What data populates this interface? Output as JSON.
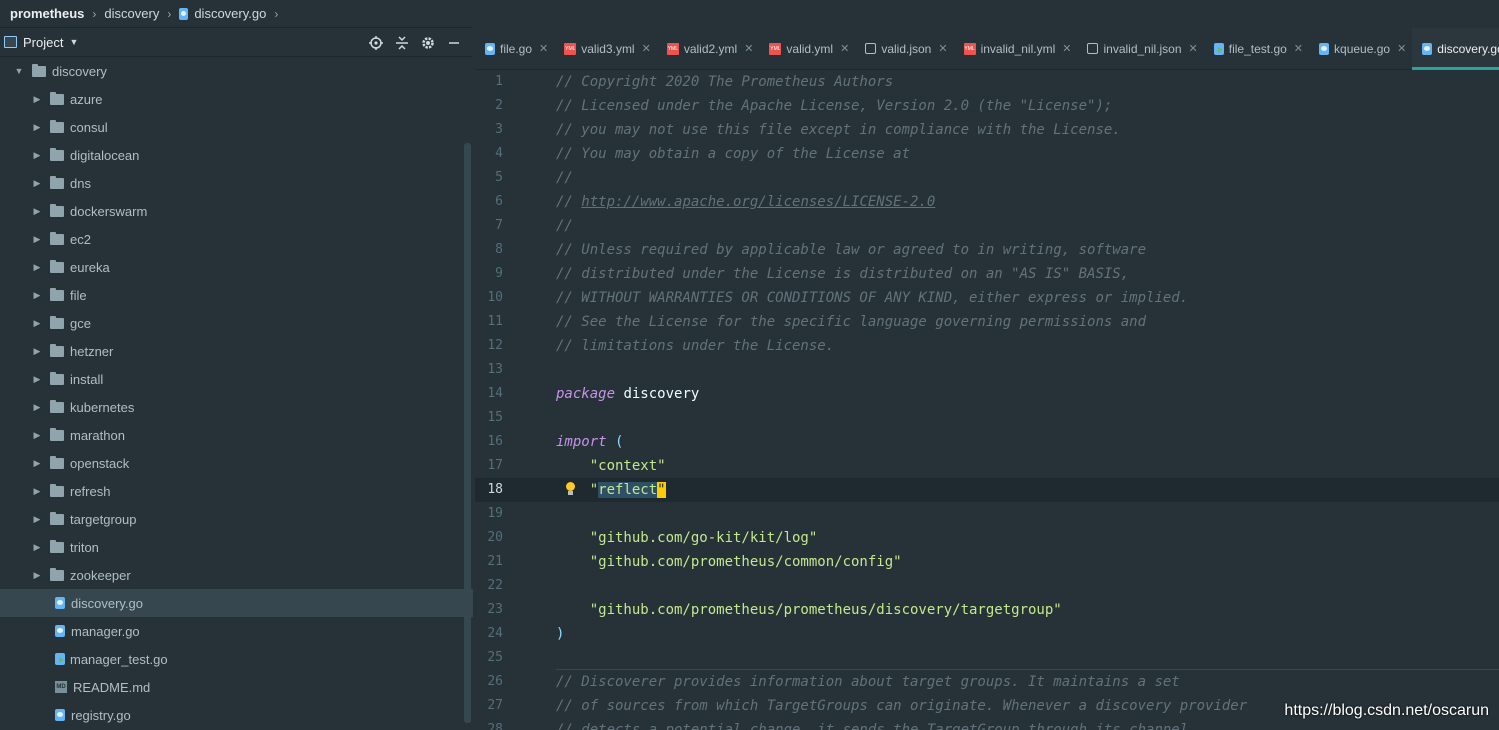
{
  "breadcrumb": {
    "root": "prometheus",
    "folder": "discovery",
    "file": "discovery.go"
  },
  "project": {
    "label": "Project"
  },
  "tree": [
    {
      "name": "discovery",
      "kind": "folder",
      "expanded": true,
      "depth": 0
    },
    {
      "name": "azure",
      "kind": "folder",
      "depth": 1
    },
    {
      "name": "consul",
      "kind": "folder",
      "depth": 1
    },
    {
      "name": "digitalocean",
      "kind": "folder",
      "depth": 1
    },
    {
      "name": "dns",
      "kind": "folder",
      "depth": 1
    },
    {
      "name": "dockerswarm",
      "kind": "folder",
      "depth": 1
    },
    {
      "name": "ec2",
      "kind": "folder",
      "depth": 1
    },
    {
      "name": "eureka",
      "kind": "folder",
      "depth": 1
    },
    {
      "name": "file",
      "kind": "folder",
      "depth": 1
    },
    {
      "name": "gce",
      "kind": "folder",
      "depth": 1
    },
    {
      "name": "hetzner",
      "kind": "folder",
      "depth": 1
    },
    {
      "name": "install",
      "kind": "folder",
      "depth": 1
    },
    {
      "name": "kubernetes",
      "kind": "folder",
      "depth": 1
    },
    {
      "name": "marathon",
      "kind": "folder",
      "depth": 1
    },
    {
      "name": "openstack",
      "kind": "folder",
      "depth": 1
    },
    {
      "name": "refresh",
      "kind": "folder",
      "depth": 1
    },
    {
      "name": "targetgroup",
      "kind": "folder",
      "depth": 1
    },
    {
      "name": "triton",
      "kind": "folder",
      "depth": 1
    },
    {
      "name": "zookeeper",
      "kind": "folder",
      "depth": 1
    },
    {
      "name": "discovery.go",
      "kind": "go",
      "depth": 1,
      "selected": true
    },
    {
      "name": "manager.go",
      "kind": "go",
      "depth": 1
    },
    {
      "name": "manager_test.go",
      "kind": "test",
      "depth": 1
    },
    {
      "name": "README.md",
      "kind": "md",
      "depth": 1
    },
    {
      "name": "registry.go",
      "kind": "go",
      "depth": 1
    }
  ],
  "tabs": [
    {
      "label": "file.go",
      "kind": "go"
    },
    {
      "label": "valid3.yml",
      "kind": "yml"
    },
    {
      "label": "valid2.yml",
      "kind": "yml"
    },
    {
      "label": "valid.yml",
      "kind": "yml"
    },
    {
      "label": "valid.json",
      "kind": "json"
    },
    {
      "label": "invalid_nil.yml",
      "kind": "yml"
    },
    {
      "label": "invalid_nil.json",
      "kind": "json"
    },
    {
      "label": "file_test.go",
      "kind": "test"
    },
    {
      "label": "kqueue.go",
      "kind": "go"
    },
    {
      "label": "discovery.go",
      "kind": "go",
      "active": true
    }
  ],
  "icon_names": {
    "yml_badge": "YML",
    "md_badge": "MD"
  },
  "code": [
    {
      "n": "1",
      "tokens": [
        [
          "comment",
          "// Copyright 2020 The Prometheus Authors"
        ]
      ]
    },
    {
      "n": "2",
      "tokens": [
        [
          "comment",
          "// Licensed under the Apache License, Version 2.0 (the \"License\");"
        ]
      ]
    },
    {
      "n": "3",
      "tokens": [
        [
          "comment",
          "// you may not use this file except in compliance with the License."
        ]
      ]
    },
    {
      "n": "4",
      "tokens": [
        [
          "comment",
          "// You may obtain a copy of the License at"
        ]
      ]
    },
    {
      "n": "5",
      "tokens": [
        [
          "comment",
          "//"
        ]
      ]
    },
    {
      "n": "6",
      "tokens": [
        [
          "comment",
          "// "
        ],
        [
          "link",
          "http://www.apache.org/licenses/LICENSE-2.0"
        ]
      ]
    },
    {
      "n": "7",
      "tokens": [
        [
          "comment",
          "//"
        ]
      ]
    },
    {
      "n": "8",
      "tokens": [
        [
          "comment",
          "// Unless required by applicable law or agreed to in writing, software"
        ]
      ]
    },
    {
      "n": "9",
      "tokens": [
        [
          "comment",
          "// distributed under the License is distributed on an \"AS IS\" BASIS,"
        ]
      ]
    },
    {
      "n": "10",
      "tokens": [
        [
          "comment",
          "// WITHOUT WARRANTIES OR CONDITIONS OF ANY KIND, either express or implied."
        ]
      ]
    },
    {
      "n": "11",
      "tokens": [
        [
          "comment",
          "// See the License for the specific language governing permissions and"
        ]
      ]
    },
    {
      "n": "12",
      "tokens": [
        [
          "comment",
          "// limitations under the License."
        ]
      ]
    },
    {
      "n": "13",
      "tokens": []
    },
    {
      "n": "14",
      "tokens": [
        [
          "kw",
          "package"
        ],
        [
          "plain",
          " discovery"
        ]
      ]
    },
    {
      "n": "15",
      "tokens": []
    },
    {
      "n": "16",
      "tokens": [
        [
          "kw",
          "import"
        ],
        [
          "punct",
          " ("
        ]
      ]
    },
    {
      "n": "17",
      "tokens": [
        [
          "str",
          "    \"context\""
        ]
      ]
    },
    {
      "n": "18",
      "tokens": [
        [
          "str",
          "    \""
        ],
        [
          "sel",
          "reflect"
        ],
        [
          "caret",
          "\""
        ]
      ],
      "current": true
    },
    {
      "n": "19",
      "tokens": []
    },
    {
      "n": "20",
      "tokens": [
        [
          "str",
          "    \"github.com/go-kit/kit/log\""
        ]
      ]
    },
    {
      "n": "21",
      "tokens": [
        [
          "str",
          "    \"github.com/prometheus/common/config\""
        ]
      ]
    },
    {
      "n": "22",
      "tokens": []
    },
    {
      "n": "23",
      "tokens": [
        [
          "str",
          "    \"github.com/prometheus/prometheus/discovery/targetgroup\""
        ]
      ]
    },
    {
      "n": "24",
      "tokens": [
        [
          "punct",
          ")"
        ]
      ]
    },
    {
      "n": "25",
      "tokens": []
    },
    {
      "n": "26",
      "tokens": [
        [
          "comment",
          "// Discoverer provides information about target groups. It maintains a set"
        ]
      ]
    },
    {
      "n": "27",
      "tokens": [
        [
          "comment",
          "// of sources from which TargetGroups can originate. Whenever a discovery provider"
        ]
      ]
    },
    {
      "n": "28",
      "tokens": [
        [
          "comment",
          "// detects a potential change, it sends the TargetGroup through its channel."
        ]
      ]
    }
  ],
  "watermark": "https://blog.csdn.net/oscarun"
}
